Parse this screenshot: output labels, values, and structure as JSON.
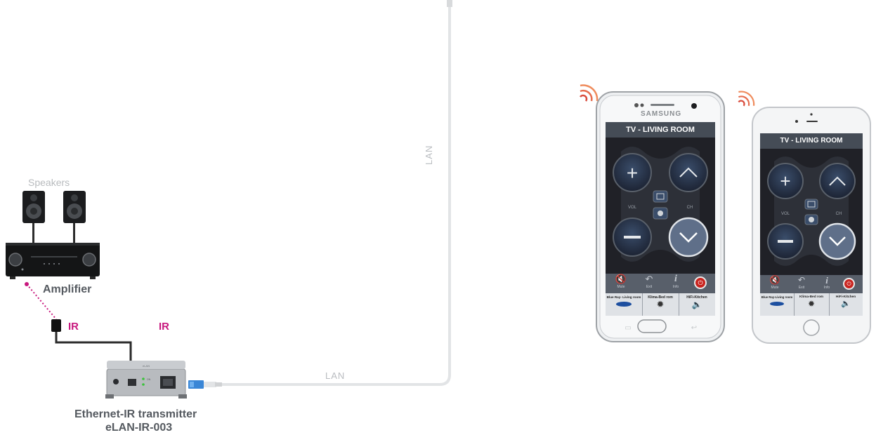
{
  "diagram": {
    "speakers_label": "Speakers",
    "amplifier_label": "Amplifier",
    "ir_label_left": "IR",
    "ir_label_right": "IR",
    "lan_label_horizontal": "LAN",
    "lan_label_vertical": "LAN",
    "transmitter_label_line1": "Ethernet-IR transmitter",
    "transmitter_label_line2": "eLAN-IR-003",
    "accent_color": "#c8187e",
    "cable_color": "#e2e4e6"
  },
  "phone_samsung": {
    "brand": "SAMSUNG",
    "screen_title": "TV - LIVING ROOM",
    "vol_label": "VOL",
    "ch_label": "CH",
    "buttons": [
      {
        "label": "Mute",
        "icon": "mute-icon"
      },
      {
        "label": "Exit",
        "icon": "exit-icon"
      },
      {
        "label": "Info",
        "icon": "info-icon"
      },
      {
        "label": "",
        "icon": "power-icon"
      }
    ],
    "shortcuts": [
      {
        "label": "Blue Ray- Living room",
        "icon": "bluray-icon"
      },
      {
        "label": "Klima-Bed rom",
        "icon": "sun-icon"
      },
      {
        "label": "HiFi-Kitchen",
        "icon": "speaker-icon"
      }
    ]
  },
  "phone_iphone": {
    "screen_title": "TV - LIVING ROOM",
    "vol_label": "VOL",
    "ch_label": "CH",
    "buttons": [
      {
        "label": "Mute",
        "icon": "mute-icon"
      },
      {
        "label": "Exit",
        "icon": "exit-icon"
      },
      {
        "label": "Info",
        "icon": "info-icon"
      },
      {
        "label": "",
        "icon": "power-icon"
      }
    ],
    "shortcuts": [
      {
        "label": "Blue Ray-Living room",
        "icon": "bluray-icon"
      },
      {
        "label": "Klima-Bed rom",
        "icon": "sun-icon"
      },
      {
        "label": "HiFi-Kitchen",
        "icon": "speaker-icon"
      }
    ]
  }
}
